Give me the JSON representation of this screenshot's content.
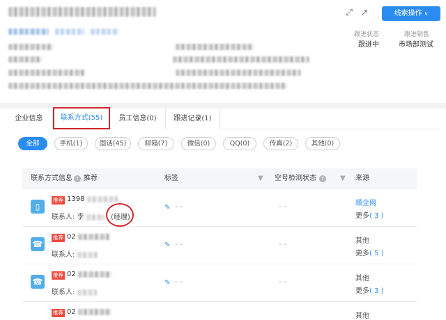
{
  "header": {
    "company_name": "",
    "actions": {
      "primary_label": "线索操作",
      "fullscreen_icon": "fullscreen-icon",
      "popout_icon": "external-link-icon"
    },
    "stats": [
      {
        "label": "跟进状态",
        "value": "跟进中"
      },
      {
        "label": "跟进销售",
        "value": "市场部测试"
      }
    ]
  },
  "tabs": [
    {
      "label": "企业信息",
      "active": false
    },
    {
      "label": "联系方式(55)",
      "active": true
    },
    {
      "label": "员工信息(0)",
      "active": false
    },
    {
      "label": "跟进记录(1)",
      "active": false
    }
  ],
  "filters": [
    {
      "label": "全部",
      "active": true
    },
    {
      "label": "手机(1)",
      "active": false
    },
    {
      "label": "固话(45)",
      "active": false
    },
    {
      "label": "邮箱(7)",
      "active": false
    },
    {
      "label": "微信(0)",
      "active": false
    },
    {
      "label": "QQ(0)",
      "active": false
    },
    {
      "label": "传真(2)",
      "active": false
    },
    {
      "label": "其他(0)",
      "active": false
    }
  ],
  "table": {
    "columns": {
      "contact": "联系方式信息",
      "recommend": "推荐",
      "tag": "标签",
      "check": "空号检测状态",
      "source": "来源"
    },
    "rows": [
      {
        "type": "mobile",
        "badge": "推荐",
        "phone": "1398",
        "contact_prefix": "联系人: 李",
        "title": "(经理)",
        "tag": "- -",
        "check": "- -",
        "source": "顺企网",
        "source_link": true,
        "more_label": "更多",
        "more_count": "( 3 )"
      },
      {
        "type": "landline",
        "badge": "推荐",
        "phone": "02",
        "contact_prefix": "联系人:",
        "title": "",
        "tag": "- -",
        "check": "- -",
        "source": "其他",
        "source_link": false,
        "more_label": "更多",
        "more_count": "( 5 )"
      },
      {
        "type": "landline",
        "badge": "推荐",
        "phone": "02",
        "contact_prefix": "联系人:",
        "title": "",
        "tag": "- -",
        "check": "- -",
        "source": "其他",
        "source_link": false,
        "more_label": "更多",
        "more_count": "( 3 )"
      },
      {
        "type": "landline",
        "badge": "推荐",
        "phone": "02",
        "contact_prefix": "",
        "title": "",
        "tag": "",
        "check": "",
        "source": "其他",
        "source_link": false,
        "more_label": "",
        "more_count": ""
      }
    ]
  }
}
